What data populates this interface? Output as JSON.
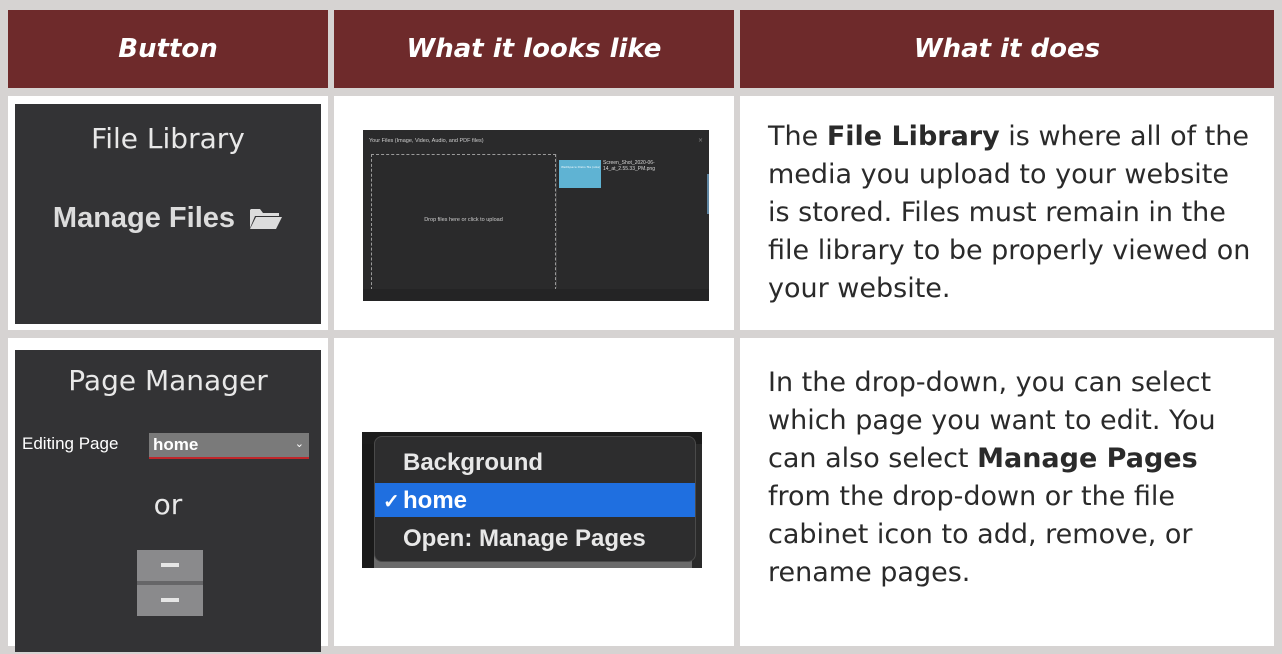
{
  "table": {
    "headers": {
      "button": "Button",
      "looks_like": "What it looks like",
      "does": "What it does"
    }
  },
  "row1": {
    "button_label": "File Library",
    "button_sub": "Manage Files",
    "screenshot": {
      "title": "Your Files (Image, Video, Audio, and PDF files)",
      "close": "×",
      "drop_text": "Drop files here or click to upload",
      "thumb_text": "WebSpace Disks file (size)",
      "file_name": "Screen_Shot_2020-06-14_at_2.55.33_PM.png"
    },
    "desc_pre": "The ",
    "desc_bold": "File Library",
    "desc_post": " is where all of the media you upload to your website is stored. Files must remain in the file library to be properly viewed on your website."
  },
  "row2": {
    "button_label": "Page Manager",
    "editing_label": "Editing Page",
    "select_value": "home",
    "or_text": "or",
    "dropdown": {
      "items": [
        "Background",
        "home",
        "Open: Manage Pages"
      ],
      "selected_index": 1,
      "check": "✓"
    },
    "desc_pre": "In the drop-down, you can select which page you want to edit. You can also select ",
    "desc_bold": "Manage Pages",
    "desc_post": " from the drop-down or the file cabinet icon to add, remove, or rename pages."
  },
  "colors": {
    "header_bg": "#6e2a2b",
    "dark_cell": "#333335",
    "select_accent": "#c0262a",
    "selected_item": "#1f6fe0"
  }
}
